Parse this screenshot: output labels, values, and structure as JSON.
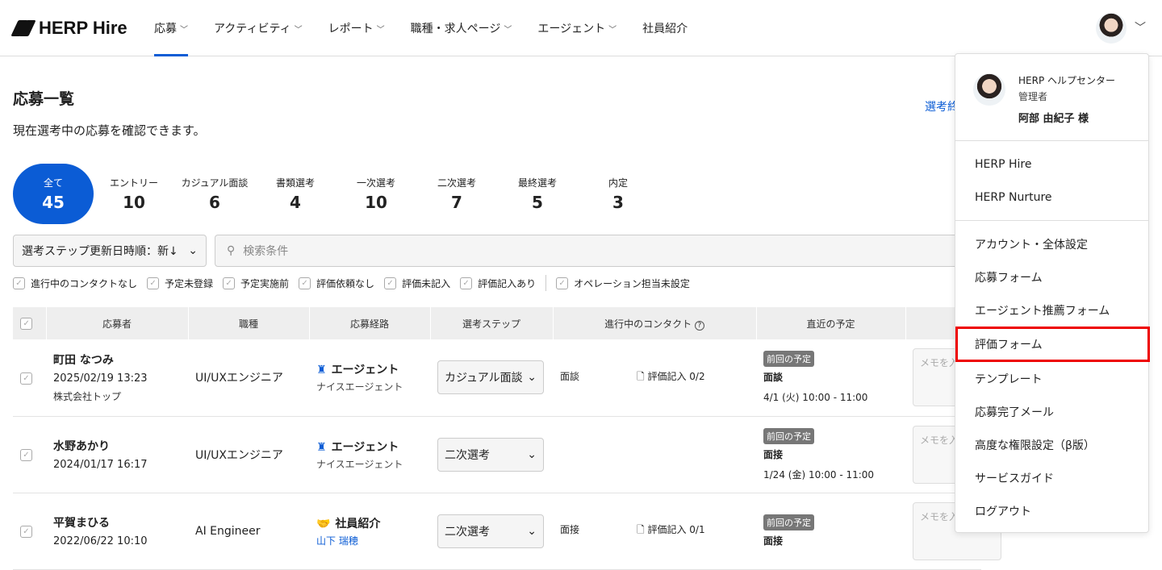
{
  "header": {
    "logo": "HERP Hire",
    "nav": [
      {
        "label": "応募",
        "active": true
      },
      {
        "label": "アクティビティ"
      },
      {
        "label": "レポート"
      },
      {
        "label": "職種・求人ページ"
      },
      {
        "label": "エージェント"
      },
      {
        "label": "社員紹介"
      }
    ]
  },
  "page": {
    "title": "応募一覧",
    "subtitle": "現在選考中の応募を確認できます。",
    "closed_link": "選考終"
  },
  "stats": [
    {
      "label": "全て",
      "count": "45"
    },
    {
      "label": "エントリー",
      "count": "10"
    },
    {
      "label": "カジュアル面談",
      "count": "6"
    },
    {
      "label": "書類選考",
      "count": "4"
    },
    {
      "label": "一次選考",
      "count": "10"
    },
    {
      "label": "二次選考",
      "count": "7"
    },
    {
      "label": "最終選考",
      "count": "5"
    },
    {
      "label": "内定",
      "count": "3"
    }
  ],
  "sort": {
    "value": "選考ステップ更新日時順：新↓"
  },
  "search": {
    "placeholder": "検索条件"
  },
  "filters": [
    "進行中のコンタクトなし",
    "予定未登録",
    "予定実施前",
    "評価依頼なし",
    "評価未記入",
    "評価記入あり",
    "オペレーション担当未設定"
  ],
  "table": {
    "headers": [
      "応募者",
      "職種",
      "応募経路",
      "選考ステップ",
      "進行中のコンタクト",
      "直近の予定"
    ],
    "help_icon": "?",
    "rows": [
      {
        "name": "町田 なつみ",
        "date": "2025/02/19 13:23",
        "company": "株式会社トップ",
        "job": "UI/UXエンジニア",
        "route": "エージェント",
        "route_sub": "ナイスエージェント",
        "step": "カジュアル面談",
        "contact_type": "面談",
        "contact_eval": "評価記入 0/2",
        "badge": "前回の予定",
        "sch_type": "面談",
        "sch_date": "4/1 (火) 10:00 - 11:00",
        "memo": "メモを入"
      },
      {
        "name": "水野あかり",
        "date": "2024/01/17 16:17",
        "company": "",
        "job": "UI/UXエンジニア",
        "route": "エージェント",
        "route_sub": "ナイスエージェント",
        "step": "二次選考",
        "contact_type": "",
        "contact_eval": "",
        "badge": "前回の予定",
        "sch_type": "面接",
        "sch_date": "1/24 (金) 10:00 - 11:00",
        "memo": "メモを入"
      },
      {
        "name": "平賀まひる",
        "date": "2022/06/22 10:10",
        "company": "",
        "job": "AI Engineer",
        "route": "社員紹介",
        "route_sub": "山下 瑞穂",
        "step": "二次選考",
        "contact_type": "面接",
        "contact_eval": "評価記入 0/1",
        "badge": "前回の予定",
        "sch_type": "面接",
        "sch_date": "",
        "memo": "メモを入"
      }
    ]
  },
  "menu": {
    "org": "HERP ヘルプセンター",
    "role": "管理者",
    "user": "阿部 由紀子 様",
    "products": [
      "HERP Hire",
      "HERP Nurture"
    ],
    "items": [
      "アカウント・全体設定",
      "応募フォーム",
      "エージェント推薦フォーム",
      "評価フォーム",
      "テンプレート",
      "応募完了メール",
      "高度な権限設定（β版）",
      "サービスガイド",
      "ログアウト"
    ],
    "highlighted": "評価フォーム"
  },
  "colors": {
    "accent": "#0b5cd5",
    "highlight": "#e00000"
  }
}
